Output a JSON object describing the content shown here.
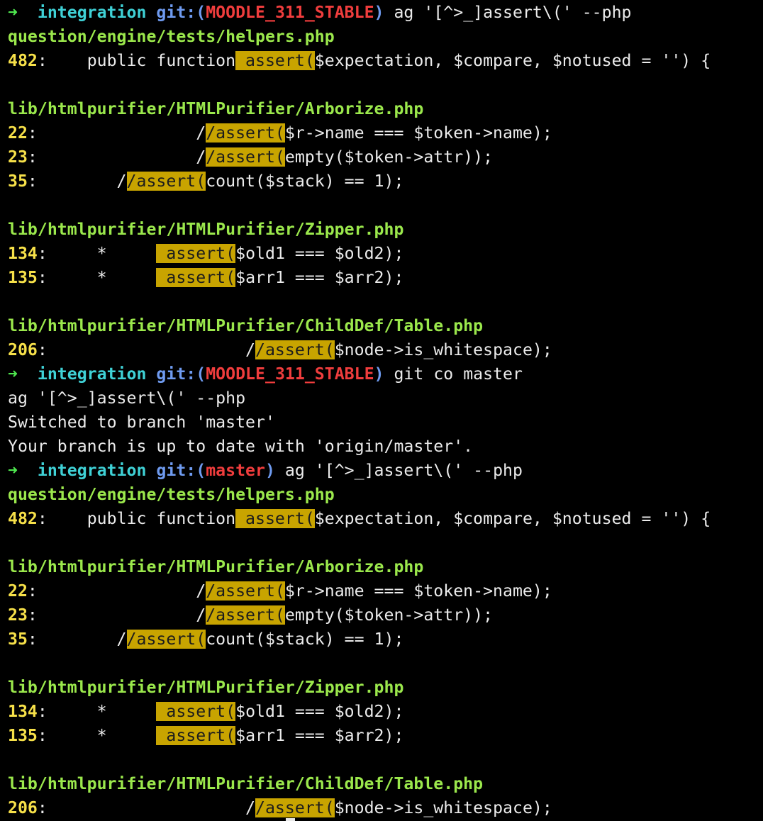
{
  "theme": {
    "background": "#000000",
    "text": "#ebebeb",
    "prompt_arrow": "#4fe84f",
    "prompt_dir": "#3fd1d6",
    "git_label": "#6f9bf0",
    "branch": "#f03d3d",
    "file_path": "#9be84c",
    "line_number": "#f6e049",
    "match_highlight": "#c8a400"
  },
  "lines": [
    {
      "segs": [
        {
          "t": "➜ ",
          "c": "arrow"
        },
        {
          "t": " integration",
          "c": "dir"
        },
        {
          "t": " git:(",
          "c": "gitlabel"
        },
        {
          "t": "MOODLE_311_STABLE",
          "c": "branch"
        },
        {
          "t": ")",
          "c": "gitlabel"
        },
        {
          "t": " ag '[^>_]assert\\(' --php"
        }
      ]
    },
    {
      "segs": [
        {
          "t": "question/engine/tests/helpers.php",
          "c": "path"
        }
      ]
    },
    {
      "segs": [
        {
          "t": "482",
          "c": "lnum"
        },
        {
          "t": ":    public function"
        },
        {
          "t": " assert(",
          "c": "hit"
        },
        {
          "t": "$expectation, $compare, $notused = '') {"
        }
      ]
    },
    {
      "segs": []
    },
    {
      "segs": [
        {
          "t": "lib/htmlpurifier/HTMLPurifier/Arborize.php",
          "c": "path"
        }
      ]
    },
    {
      "segs": [
        {
          "t": "22",
          "c": "lnum"
        },
        {
          "t": ":                /"
        },
        {
          "t": "/assert(",
          "c": "hit"
        },
        {
          "t": "$r->name === $token->name);"
        }
      ]
    },
    {
      "segs": [
        {
          "t": "23",
          "c": "lnum"
        },
        {
          "t": ":                /"
        },
        {
          "t": "/assert(",
          "c": "hit"
        },
        {
          "t": "empty($token->attr));"
        }
      ]
    },
    {
      "segs": [
        {
          "t": "35",
          "c": "lnum"
        },
        {
          "t": ":        /"
        },
        {
          "t": "/assert(",
          "c": "hit"
        },
        {
          "t": "count($stack) == 1);"
        }
      ]
    },
    {
      "segs": []
    },
    {
      "segs": [
        {
          "t": "lib/htmlpurifier/HTMLPurifier/Zipper.php",
          "c": "path"
        }
      ]
    },
    {
      "segs": [
        {
          "t": "134",
          "c": "lnum"
        },
        {
          "t": ":     *     "
        },
        {
          "t": " assert(",
          "c": "hit"
        },
        {
          "t": "$old1 === $old2);"
        }
      ]
    },
    {
      "segs": [
        {
          "t": "135",
          "c": "lnum"
        },
        {
          "t": ":     *     "
        },
        {
          "t": " assert(",
          "c": "hit"
        },
        {
          "t": "$arr1 === $arr2);"
        }
      ]
    },
    {
      "segs": []
    },
    {
      "segs": [
        {
          "t": "lib/htmlpurifier/HTMLPurifier/ChildDef/Table.php",
          "c": "path"
        }
      ]
    },
    {
      "segs": [
        {
          "t": "206",
          "c": "lnum"
        },
        {
          "t": ":                    /"
        },
        {
          "t": "/assert(",
          "c": "hit"
        },
        {
          "t": "$node->is_whitespace);"
        }
      ]
    },
    {
      "segs": [
        {
          "t": "➜ ",
          "c": "arrow"
        },
        {
          "t": " integration",
          "c": "dir"
        },
        {
          "t": " git:(",
          "c": "gitlabel"
        },
        {
          "t": "MOODLE_311_STABLE",
          "c": "branch"
        },
        {
          "t": ")",
          "c": "gitlabel"
        },
        {
          "t": " git co master"
        }
      ]
    },
    {
      "segs": [
        {
          "t": "ag '[^>_]assert\\(' --php"
        }
      ]
    },
    {
      "segs": [
        {
          "t": "Switched to branch 'master'"
        }
      ]
    },
    {
      "segs": [
        {
          "t": "Your branch is up to date with 'origin/master'."
        }
      ]
    },
    {
      "segs": [
        {
          "t": "➜ ",
          "c": "arrow"
        },
        {
          "t": " integration",
          "c": "dir"
        },
        {
          "t": " git:(",
          "c": "gitlabel"
        },
        {
          "t": "master",
          "c": "branch"
        },
        {
          "t": ")",
          "c": "gitlabel"
        },
        {
          "t": " ag '[^>_]assert\\(' --php"
        }
      ]
    },
    {
      "segs": [
        {
          "t": "question/engine/tests/helpers.php",
          "c": "path"
        }
      ]
    },
    {
      "segs": [
        {
          "t": "482",
          "c": "lnum"
        },
        {
          "t": ":    public function"
        },
        {
          "t": " assert(",
          "c": "hit"
        },
        {
          "t": "$expectation, $compare, $notused = '') {"
        }
      ]
    },
    {
      "segs": []
    },
    {
      "segs": [
        {
          "t": "lib/htmlpurifier/HTMLPurifier/Arborize.php",
          "c": "path"
        }
      ]
    },
    {
      "segs": [
        {
          "t": "22",
          "c": "lnum"
        },
        {
          "t": ":                /"
        },
        {
          "t": "/assert(",
          "c": "hit"
        },
        {
          "t": "$r->name === $token->name);"
        }
      ]
    },
    {
      "segs": [
        {
          "t": "23",
          "c": "lnum"
        },
        {
          "t": ":                /"
        },
        {
          "t": "/assert(",
          "c": "hit"
        },
        {
          "t": "empty($token->attr));"
        }
      ]
    },
    {
      "segs": [
        {
          "t": "35",
          "c": "lnum"
        },
        {
          "t": ":        /"
        },
        {
          "t": "/assert(",
          "c": "hit"
        },
        {
          "t": "count($stack) == 1);"
        }
      ]
    },
    {
      "segs": []
    },
    {
      "segs": [
        {
          "t": "lib/htmlpurifier/HTMLPurifier/Zipper.php",
          "c": "path"
        }
      ]
    },
    {
      "segs": [
        {
          "t": "134",
          "c": "lnum"
        },
        {
          "t": ":     *     "
        },
        {
          "t": " assert(",
          "c": "hit"
        },
        {
          "t": "$old1 === $old2);"
        }
      ]
    },
    {
      "segs": [
        {
          "t": "135",
          "c": "lnum"
        },
        {
          "t": ":     *     "
        },
        {
          "t": " assert(",
          "c": "hit"
        },
        {
          "t": "$arr1 === $arr2);"
        }
      ]
    },
    {
      "segs": []
    },
    {
      "segs": [
        {
          "t": "lib/htmlpurifier/HTMLPurifier/ChildDef/Table.php",
          "c": "path"
        }
      ]
    },
    {
      "segs": [
        {
          "t": "206",
          "c": "lnum"
        },
        {
          "t": ":                    /"
        },
        {
          "t": "/assert(",
          "c": "hit"
        },
        {
          "t": "$node->is_whitespace);"
        }
      ]
    }
  ]
}
